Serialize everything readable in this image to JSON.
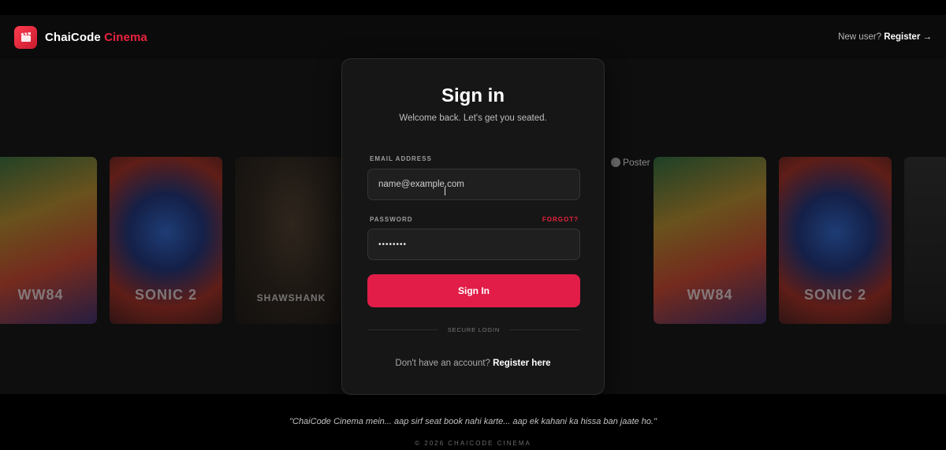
{
  "brand": {
    "name": "ChaiCode",
    "accent_name": "Cinema",
    "accent_color": "#e9233f",
    "logo_icon": "clapperboard-icon"
  },
  "nav": {
    "prompt": "New user?",
    "register_label": "Register →"
  },
  "posters": [
    {
      "name": "wonder-woman-84",
      "title": "WW84"
    },
    {
      "name": "sonic-2",
      "title": "SONIC 2"
    },
    {
      "name": "shawshank",
      "title": "SHAWSHANK"
    },
    {
      "name": "broken-poster",
      "alt": "Poster"
    },
    {
      "name": "wonder-woman-84",
      "title": "WW84"
    },
    {
      "name": "sonic-2",
      "title": "SONIC 2"
    }
  ],
  "card": {
    "title": "Sign in",
    "subtitle": "Welcome back. Let's get you seated.",
    "email_label": "EMAIL ADDRESS",
    "email_value": "name@example.com",
    "password_label": "PASSWORD",
    "forgot_label": "FORGOT?",
    "password_value": "••••••••",
    "submit_label": "Sign In",
    "divider_text": "SECURE LOGIN",
    "no_account_text": "Don't have an account?",
    "register_link": "Register here",
    "button_color": "#e11d48"
  },
  "footer": {
    "quote": "\"ChaiCode Cinema mein... aap sirf seat book nahi karte... aap ek kahani ka hissa ban jaate ho.\"",
    "copyright": "© 2026 CHAICODE CINEMA"
  }
}
